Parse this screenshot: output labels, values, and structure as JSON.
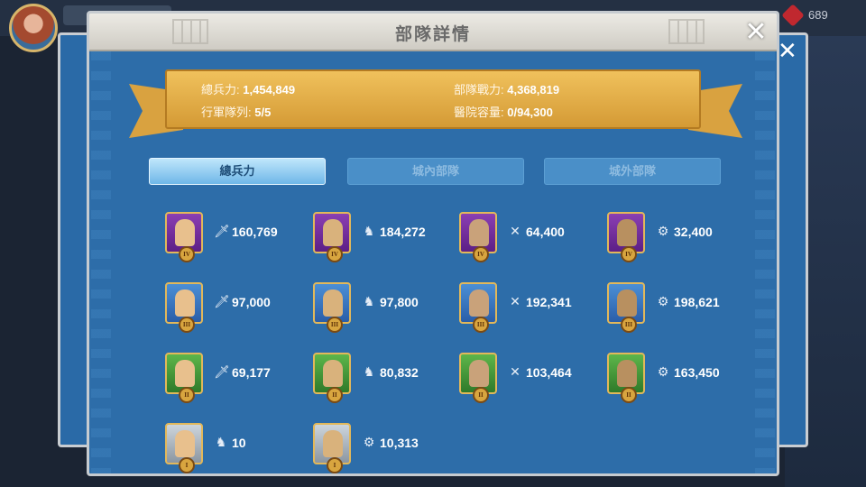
{
  "hud": {
    "gem_count": "689"
  },
  "panel": {
    "title": "部隊詳情",
    "close_glyph": "✕"
  },
  "stats": {
    "total_troops_label": "總兵力:",
    "total_troops_value": "1,454,849",
    "power_label": "部隊戰力:",
    "power_value": "4,368,819",
    "march_label": "行軍隊列:",
    "march_value": "5/5",
    "hospital_label": "醫院容量:",
    "hospital_value": "0/94,300"
  },
  "tabs": [
    {
      "label": "總兵力",
      "active": true
    },
    {
      "label": "城內部隊",
      "active": false
    },
    {
      "label": "城外部隊",
      "active": false
    }
  ],
  "troops": [
    {
      "tier": "IV",
      "type": "infantry",
      "icon": "sword-icon",
      "count": "160,769"
    },
    {
      "tier": "IV",
      "type": "cavalry",
      "icon": "horse-icon",
      "count": "184,272"
    },
    {
      "tier": "IV",
      "type": "archer",
      "icon": "bow-icon",
      "count": "64,400"
    },
    {
      "tier": "IV",
      "type": "siege",
      "icon": "siege-icon",
      "count": "32,400"
    },
    {
      "tier": "III",
      "type": "infantry",
      "icon": "sword-icon",
      "count": "97,000"
    },
    {
      "tier": "III",
      "type": "cavalry",
      "icon": "horse-icon",
      "count": "97,800"
    },
    {
      "tier": "III",
      "type": "archer",
      "icon": "bow-icon",
      "count": "192,341"
    },
    {
      "tier": "III",
      "type": "siege",
      "icon": "siege-icon",
      "count": "198,621"
    },
    {
      "tier": "II",
      "type": "infantry",
      "icon": "sword-icon",
      "count": "69,177"
    },
    {
      "tier": "II",
      "type": "cavalry",
      "icon": "horse-icon",
      "count": "80,832"
    },
    {
      "tier": "II",
      "type": "archer",
      "icon": "bow-icon",
      "count": "103,464"
    },
    {
      "tier": "II",
      "type": "siege",
      "icon": "siege-icon",
      "count": "163,450"
    },
    {
      "tier": "I",
      "type": "infantry",
      "icon": "horse-icon",
      "count": "10"
    },
    {
      "tier": "I",
      "type": "cavalry",
      "icon": "siege-icon",
      "count": "10,313"
    }
  ],
  "colors": {
    "panel_blue": "#2d6da9",
    "banner_gold": "#e2ae47",
    "tab_active": "#8fcaef",
    "tab_inactive": "#4a8fc8"
  }
}
